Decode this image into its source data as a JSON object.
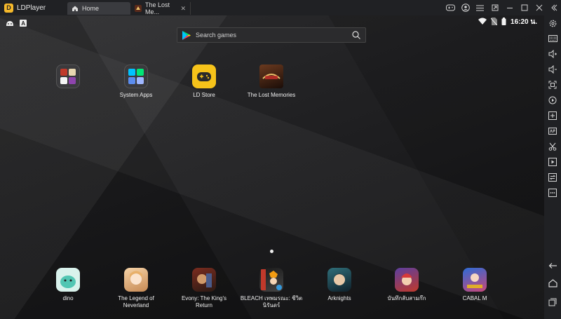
{
  "app": {
    "name": "LDPlayer"
  },
  "tabs": [
    {
      "label": "Home"
    },
    {
      "label": "The Lost Me..."
    }
  ],
  "status": {
    "time": "16:20 น."
  },
  "search": {
    "placeholder": "Search games"
  },
  "desktop_apps": [
    {
      "label": ""
    },
    {
      "label": "System Apps"
    },
    {
      "label": "LD Store"
    },
    {
      "label": "The Lost Memories"
    }
  ],
  "dock_apps": [
    {
      "label": "dino"
    },
    {
      "label": "The Legend of Neverland"
    },
    {
      "label": "Evony: The King's Return"
    },
    {
      "label": "BLEACH เทพมรณะ: ชีวิตนิรันดร์"
    },
    {
      "label": "Arknights"
    },
    {
      "label": "บันทึกลับสามก๊ก"
    },
    {
      "label": "CABAL M"
    }
  ],
  "colors": {
    "accent": "#f6b92b",
    "bg": "#1a1a1c"
  }
}
